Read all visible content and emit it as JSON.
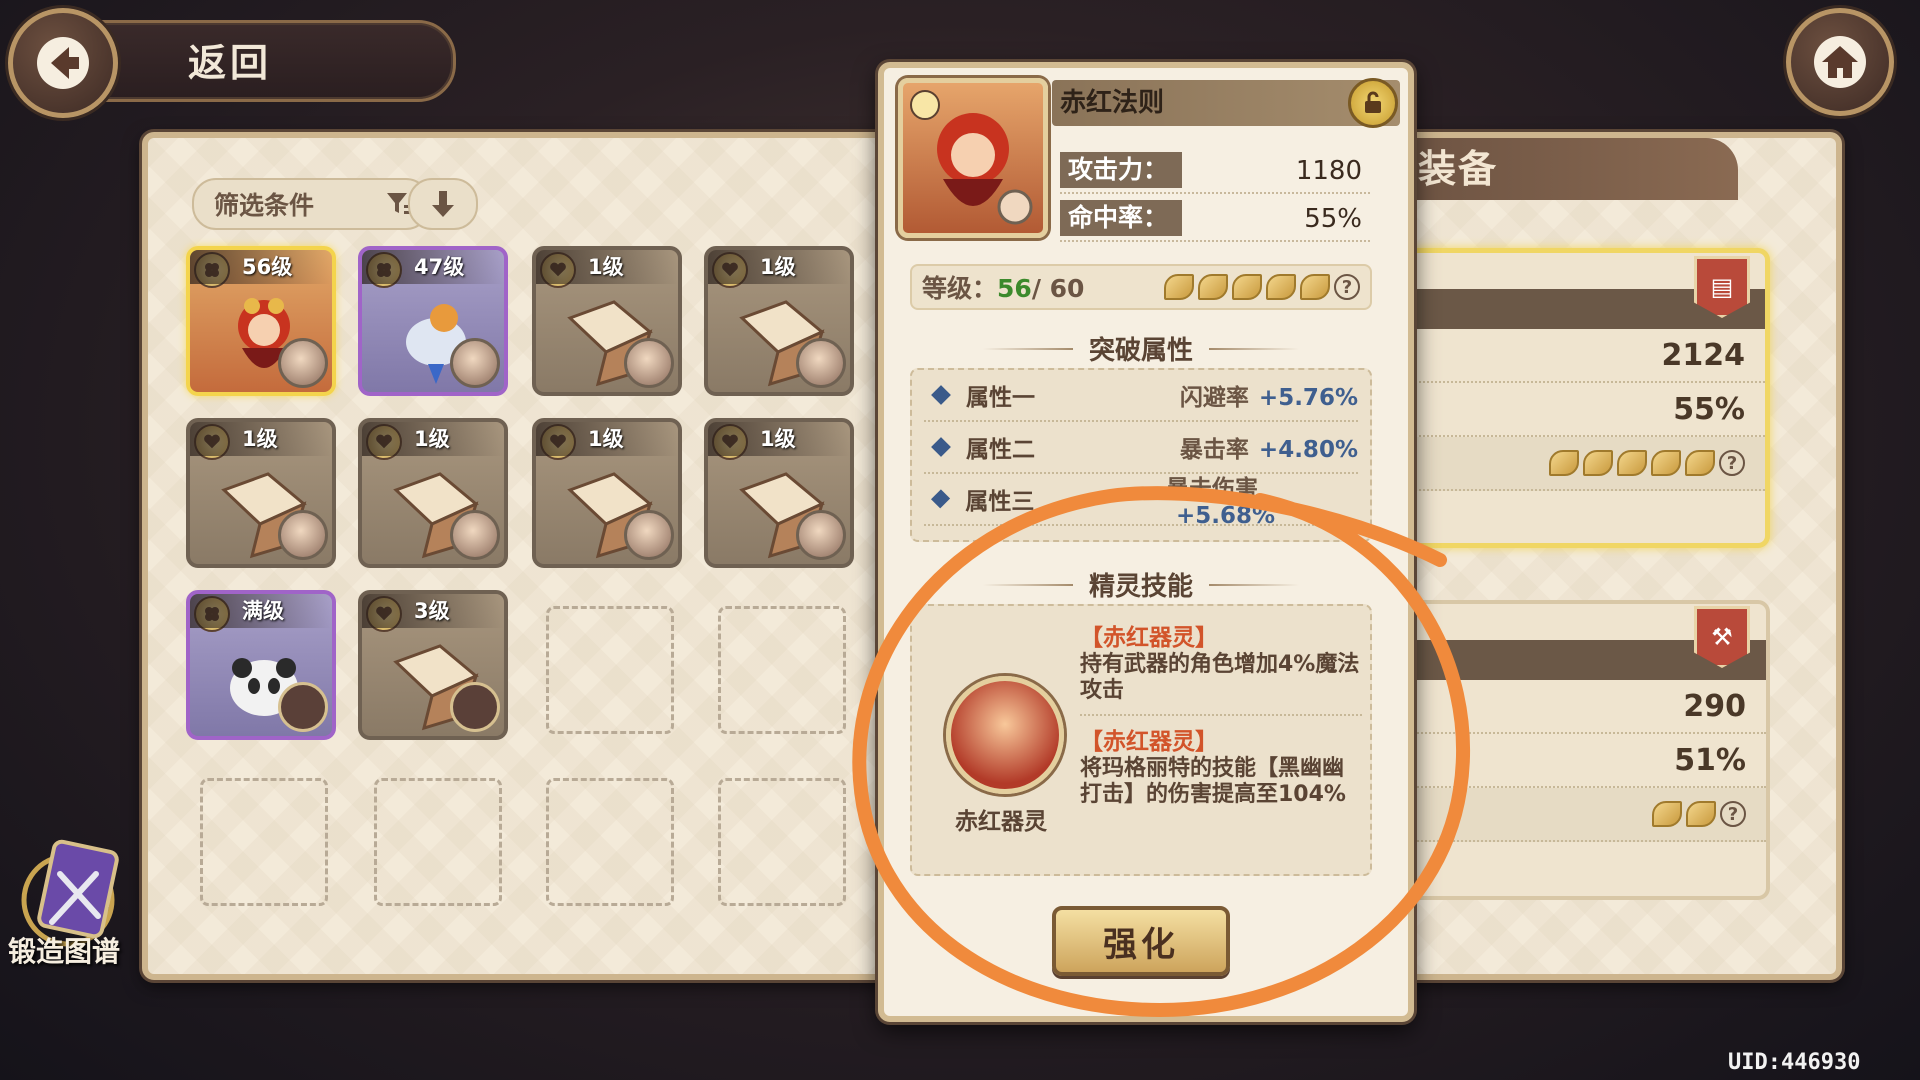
{
  "header": {
    "back_label": "返回"
  },
  "filter": {
    "label": "筛选条件"
  },
  "items": [
    {
      "level": "56级",
      "style": "gold"
    },
    {
      "level": "47级",
      "style": "purple"
    },
    {
      "level": "1级",
      "style": "normal"
    },
    {
      "level": "1级",
      "style": "normal"
    },
    {
      "level": "1级",
      "style": "normal"
    },
    {
      "level": "1级",
      "style": "normal"
    },
    {
      "level": "1级",
      "style": "normal"
    },
    {
      "level": "1级",
      "style": "normal"
    },
    {
      "level": "满级",
      "style": "purple"
    },
    {
      "level": "3级",
      "style": "normal"
    }
  ],
  "forge": {
    "label": "锻造图谱"
  },
  "detail": {
    "name": "赤红法则",
    "stats": [
      {
        "label": "攻击力：",
        "value": "1180"
      },
      {
        "label": "命中率：",
        "value": "55%"
      }
    ],
    "level_label": "等级：",
    "level_current": "56",
    "level_max": "/ 60",
    "breakthrough_title": "突破属性",
    "attributes": [
      {
        "name": "属性一",
        "stat": "闪避率",
        "value": "+5.76%"
      },
      {
        "name": "属性二",
        "stat": "暴击率",
        "value": "+4.80%"
      },
      {
        "name": "属性三",
        "stat": "暴击伤害",
        "value": "+5.68%"
      }
    ],
    "skill_title": "精灵技能",
    "skill_portrait_label": "赤红器灵",
    "skills": [
      {
        "name": "【赤红器灵】",
        "desc": "持有武器的角色增加4%魔法攻击"
      },
      {
        "name": "【赤红器灵】",
        "desc": "将玛格丽特的技能【黑幽幽打击】的伤害提高至104%"
      }
    ],
    "enhance_label": "强化"
  },
  "equipment": {
    "title": "装备",
    "cards": [
      {
        "values": [
          "2124",
          "55%"
        ],
        "leaves": 5
      },
      {
        "values": [
          "290",
          "51%"
        ],
        "leaves": 2
      }
    ]
  },
  "uid": "UID:446930",
  "colors": {
    "annotation": "#f08a3c",
    "accent_gold": "#f4d44c",
    "accent_purple": "#a064c8"
  }
}
